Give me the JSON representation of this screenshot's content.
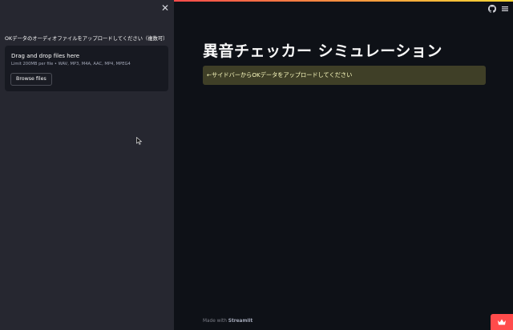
{
  "sidebar": {
    "close_glyph": "✕",
    "upload_label": "OKデータのオーディオファイルをアップロードしてください（複数可）",
    "dropzone": {
      "title": "Drag and drop files here",
      "limit": "Limit 200MB per file • WAV, MP3, M4A, AAC, MP4, MPEG4",
      "browse_label": "Browse files"
    }
  },
  "main": {
    "title": "異音チェッカー シミュレーション",
    "info": "←サイドバーからOKデータをアップロードしてください",
    "footer_prefix": "Made with ",
    "footer_brand": "Streamlit"
  },
  "icons": [
    "close-icon",
    "github-icon",
    "hamburger-menu-icon",
    "crown-icon",
    "cursor-icon"
  ],
  "colors": {
    "background": "#0e1117",
    "sidebar": "#262730",
    "accent": "#ff4b4b",
    "info_bg": "#3f3f27",
    "info_text": "#ffffc2"
  }
}
